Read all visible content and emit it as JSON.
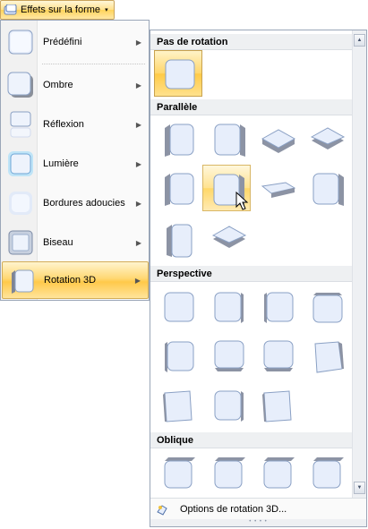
{
  "ribbon": {
    "button_label": "Effets sur la forme",
    "caret": "▾",
    "icon": "shape-effects-icon"
  },
  "menu": {
    "items": [
      {
        "label": "Prédéfini",
        "icon": "preset-effect-icon",
        "arrow": "▶"
      },
      {
        "label": "Ombre",
        "icon": "shadow-effect-icon",
        "arrow": "▶"
      },
      {
        "label": "Réflexion",
        "icon": "reflection-effect-icon",
        "arrow": "▶"
      },
      {
        "label": "Lumière",
        "icon": "glow-effect-icon",
        "arrow": "▶"
      },
      {
        "label": "Bordures adoucies",
        "icon": "soft-edges-icon",
        "arrow": "▶"
      },
      {
        "label": "Biseau",
        "icon": "bevel-effect-icon",
        "arrow": "▶"
      },
      {
        "label": "Rotation 3D",
        "icon": "3d-rotation-icon",
        "arrow": "▶",
        "selected": true
      }
    ]
  },
  "gallery": {
    "sections": {
      "no_rotation": "Pas de rotation",
      "parallel": "Parallèle",
      "perspective": "Perspective",
      "oblique": "Oblique"
    },
    "scroll_up": "▲",
    "scroll_down": "▼",
    "footer_label": "Options de rotation 3D...",
    "grip": "• • • •"
  },
  "colors": {
    "accent": "#ffd35a",
    "shape_fill": "#e7eefb",
    "shape_side": "#8c93a4",
    "shape_border": "#8aa0c4"
  }
}
